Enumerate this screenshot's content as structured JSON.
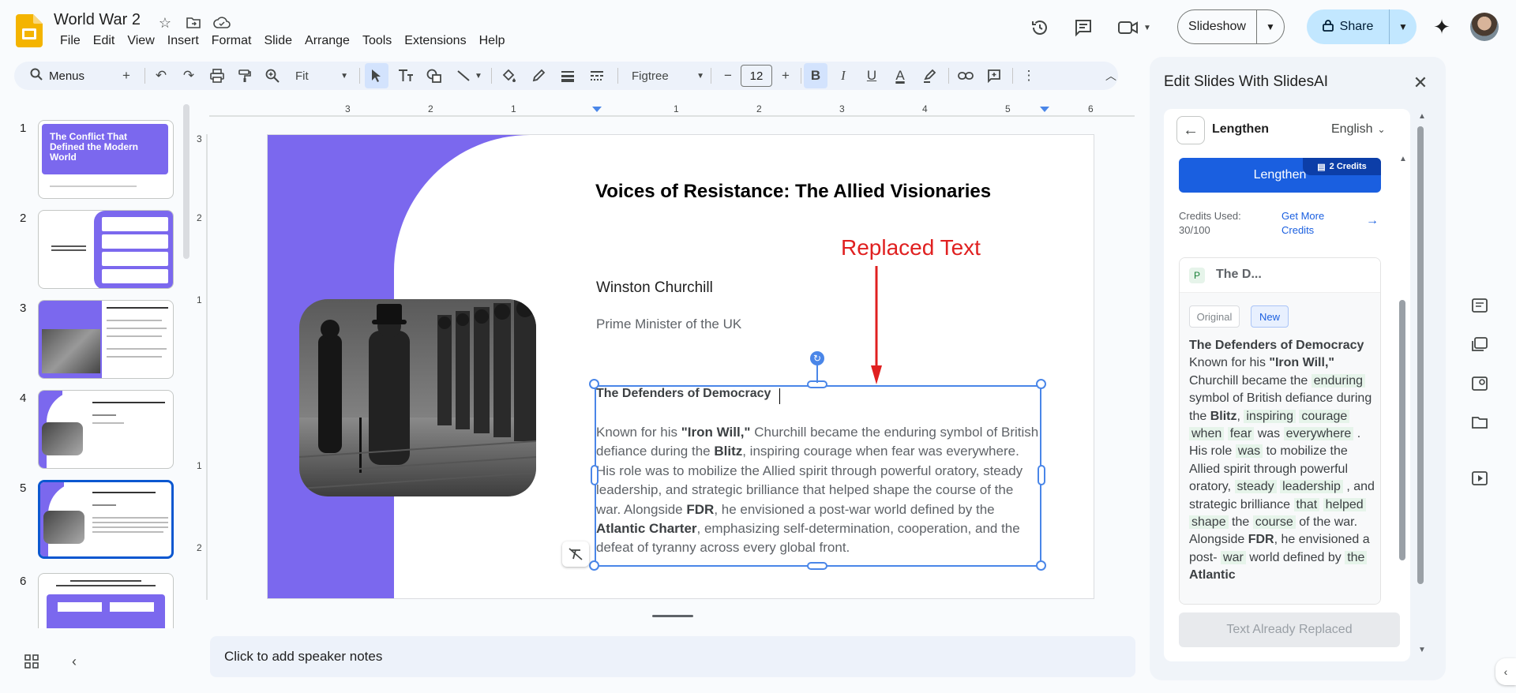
{
  "app": {
    "doc_title": "World War 2"
  },
  "menu": [
    "File",
    "Edit",
    "View",
    "Insert",
    "Format",
    "Slide",
    "Arrange",
    "Tools",
    "Extensions",
    "Help"
  ],
  "header": {
    "slideshow_label": "Slideshow",
    "share_label": "Share"
  },
  "toolbar": {
    "search_label": "Menus",
    "zoom_value": "Fit",
    "font_name": "Figtree",
    "font_size": "12"
  },
  "filmstrip": {
    "numbers": [
      "1",
      "2",
      "3",
      "4",
      "5",
      "6"
    ],
    "thumb1_title": "The Conflict That Defined the Modern World",
    "selected": 5
  },
  "rulers": {
    "h_ticks": [
      "3",
      "2",
      "1",
      "1",
      "2",
      "3",
      "4",
      "5",
      "6"
    ],
    "v_ticks": [
      "3",
      "2",
      "1",
      "1",
      "2"
    ]
  },
  "slide": {
    "title": "Voices of Resistance: The Allied Visionaries",
    "callout": "Replaced Text",
    "person_name": "Winston Churchill",
    "person_role": "Prime Minister of the UK",
    "textbox_heading": "The Defenders of Democracy",
    "body": {
      "t1": "Known for his ",
      "b1": "\"Iron Will,\"",
      "t2": " Churchill became the enduring symbol of British defiance during the ",
      "b2": "Blitz",
      "t3": ", inspiring courage when fear was everywhere. His role was to mobilize the Allied spirit through powerful oratory, steady leadership, and strategic brilliance that helped shape the course of the war. Alongside ",
      "b3": "FDR",
      "t4": ", he envisioned a post-war world defined by the ",
      "b4": "Atlantic Charter",
      "t5": ", emphasizing self-determination, cooperation, and the defeat of tyranny across every global front."
    }
  },
  "notes": {
    "placeholder": "Click to add speaker notes"
  },
  "sidepanel": {
    "title": "Edit Slides With SlidesAI",
    "mode": "Lengthen",
    "language": "English",
    "action_label": "Lengthen",
    "credits_badge": "2 Credits",
    "credits_used_label": "Credits Used:",
    "credits_used_value": "30/100",
    "get_more_label": "Get More Credits",
    "card_letter": "P",
    "card_title": "The D...",
    "tab_original": "Original",
    "tab_new": "New",
    "card": {
      "heading": "The Defenders of Democracy",
      "a1": "Known for his ",
      "a2": "\"Iron Will,\"",
      "a3": " Churchill became the ",
      "h1": "enduring",
      "a4": " symbol of British defiance during the ",
      "a5": "Blitz",
      "a6": ",",
      "h2": "inspiring",
      "h3": "courage",
      "h4": "when",
      "h5": "fear",
      "a7": " was ",
      "h6": "everywhere",
      "a8": " . His role ",
      "h7": "was",
      "a9": " to mobilize the Allied spirit through powerful oratory, ",
      "h8": "steady",
      "h9": "leadership",
      "a10": " , and strategic brilliance ",
      "h10": "that",
      "h11": "helped",
      "h12": "shape",
      "a11": " the ",
      "h13": "course",
      "a12": " of the war. Alongside ",
      "a13": "FDR",
      "a14": ", he envisioned a post- ",
      "h14": "war",
      "a15": " world defined by ",
      "h15": "the",
      "a16": "Atlantic"
    },
    "replaced_label": "Text Already Replaced"
  }
}
